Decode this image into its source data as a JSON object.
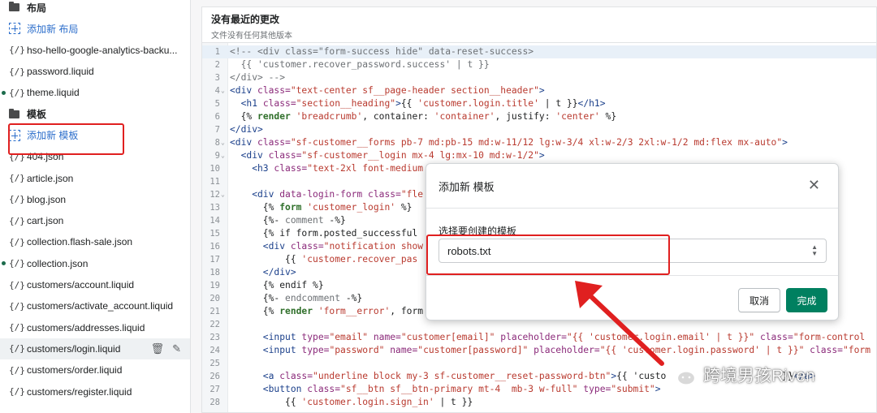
{
  "sidebar": {
    "items": [
      {
        "kind": "folder",
        "label": "布局"
      },
      {
        "kind": "add",
        "label": "添加新 布局"
      },
      {
        "kind": "file",
        "label": "hso-hello-google-analytics-backu...",
        "dot": false
      },
      {
        "kind": "file",
        "label": "password.liquid",
        "dot": false
      },
      {
        "kind": "file",
        "label": "theme.liquid",
        "dot": true
      },
      {
        "kind": "folder",
        "label": "模板"
      },
      {
        "kind": "add",
        "label": "添加新 模板"
      },
      {
        "kind": "file",
        "label": "404.json",
        "dot": false
      },
      {
        "kind": "file",
        "label": "article.json",
        "dot": false
      },
      {
        "kind": "file",
        "label": "blog.json",
        "dot": false
      },
      {
        "kind": "file",
        "label": "cart.json",
        "dot": false
      },
      {
        "kind": "file",
        "label": "collection.flash-sale.json",
        "dot": false
      },
      {
        "kind": "file",
        "label": "collection.json",
        "dot": true
      },
      {
        "kind": "file",
        "label": "customers/account.liquid",
        "dot": false
      },
      {
        "kind": "file",
        "label": "customers/activate_account.liquid",
        "dot": false
      },
      {
        "kind": "file",
        "label": "customers/addresses.liquid",
        "dot": false
      },
      {
        "kind": "file",
        "label": "customers/login.liquid",
        "dot": false,
        "selected": true
      },
      {
        "kind": "file",
        "label": "customers/order.liquid",
        "dot": false
      },
      {
        "kind": "file",
        "label": "customers/register.liquid",
        "dot": false
      }
    ],
    "file_icon": "{/}",
    "colors": {
      "link": "#2c6ecb",
      "dot": "#1c6c4c"
    }
  },
  "editor": {
    "title": "没有最近的更改",
    "subtitle": "文件没有任何其他版本",
    "lines": [
      {
        "n": "1",
        "fold": "",
        "tokens": [
          [
            "cm",
            "<!-- <div class=\"form-success hide\" data-reset-success>"
          ]
        ]
      },
      {
        "n": "2",
        "fold": "",
        "tokens": [
          [
            "cm",
            "  {{ 'customer.recover_password.success' | t }}"
          ]
        ]
      },
      {
        "n": "3",
        "fold": "",
        "tokens": [
          [
            "cm",
            "</div> -->"
          ]
        ]
      },
      {
        "n": "4",
        "fold": "v",
        "tokens": [
          [
            "tag",
            "<div "
          ],
          [
            "attr",
            "class="
          ],
          [
            "str",
            "\"text-center sf__page-header section__header\""
          ],
          [
            "tag",
            ">"
          ]
        ]
      },
      {
        "n": "5",
        "fold": "",
        "tokens": [
          [
            "tag",
            "  <h1 "
          ],
          [
            "attr",
            "class="
          ],
          [
            "str",
            "\"section__heading\""
          ],
          [
            "tag",
            ">"
          ],
          [
            "plain",
            "{{ "
          ],
          [
            "str",
            "'customer.login.title'"
          ],
          [
            "plain",
            " | t }}"
          ],
          [
            "tag",
            "</h1>"
          ]
        ]
      },
      {
        "n": "6",
        "fold": "",
        "tokens": [
          [
            "plain",
            "  {% "
          ],
          [
            "kw",
            "render "
          ],
          [
            "str",
            "'breadcrumb'"
          ],
          [
            "plain",
            ", container: "
          ],
          [
            "str",
            "'container'"
          ],
          [
            "plain",
            ", justify: "
          ],
          [
            "str",
            "'center'"
          ],
          [
            "plain",
            " %}"
          ]
        ]
      },
      {
        "n": "7",
        "fold": "",
        "tokens": [
          [
            "tag",
            "</div>"
          ]
        ]
      },
      {
        "n": "8",
        "fold": "v",
        "tokens": [
          [
            "tag",
            "<div "
          ],
          [
            "attr",
            "class="
          ],
          [
            "str",
            "\"sf-customer__forms pb-7 md:pb-15 md:w-11/12 lg:w-3/4 xl:w-2/3 2xl:w-1/2 md:flex mx-auto\""
          ],
          [
            "tag",
            ">"
          ]
        ]
      },
      {
        "n": "9",
        "fold": "v",
        "tokens": [
          [
            "tag",
            "  <div "
          ],
          [
            "attr",
            "class="
          ],
          [
            "str",
            "\"sf-customer__login mx-4 lg:mx-10 md:w-1/2\""
          ],
          [
            "tag",
            ">"
          ]
        ]
      },
      {
        "n": "10",
        "fold": "",
        "tokens": [
          [
            "tag",
            "    <h3 "
          ],
          [
            "attr",
            "class="
          ],
          [
            "str",
            "\"text-2xl font-medium"
          ]
        ]
      },
      {
        "n": "11",
        "fold": "",
        "tokens": [
          [
            "plain",
            ""
          ]
        ]
      },
      {
        "n": "12",
        "fold": "v",
        "tokens": [
          [
            "tag",
            "    <div "
          ],
          [
            "attr",
            "data-login-form class="
          ],
          [
            "str",
            "\"fle"
          ]
        ]
      },
      {
        "n": "13",
        "fold": "",
        "tokens": [
          [
            "plain",
            "      {% "
          ],
          [
            "kw",
            "form "
          ],
          [
            "str",
            "'customer_login'"
          ],
          [
            "plain",
            " %}"
          ]
        ]
      },
      {
        "n": "14",
        "fold": "",
        "tokens": [
          [
            "plain",
            "      {%- "
          ],
          [
            "cm",
            "comment"
          ],
          [
            "plain",
            " -%}"
          ]
        ]
      },
      {
        "n": "15",
        "fold": "",
        "tokens": [
          [
            "plain",
            "      {% if form.posted_successful"
          ]
        ]
      },
      {
        "n": "16",
        "fold": "",
        "tokens": [
          [
            "tag",
            "      <div "
          ],
          [
            "attr",
            "class="
          ],
          [
            "str",
            "\"notification show"
          ]
        ]
      },
      {
        "n": "17",
        "fold": "",
        "tokens": [
          [
            "plain",
            "          {{ "
          ],
          [
            "str",
            "'customer.recover_pas"
          ]
        ]
      },
      {
        "n": "18",
        "fold": "",
        "tokens": [
          [
            "tag",
            "      </div>"
          ]
        ]
      },
      {
        "n": "19",
        "fold": "",
        "tokens": [
          [
            "plain",
            "      {% endif %}"
          ]
        ]
      },
      {
        "n": "20",
        "fold": "",
        "tokens": [
          [
            "plain",
            "      {%- "
          ],
          [
            "cm",
            "endcomment"
          ],
          [
            "plain",
            " -%}"
          ]
        ]
      },
      {
        "n": "21",
        "fold": "",
        "tokens": [
          [
            "plain",
            "      {% "
          ],
          [
            "kw",
            "render "
          ],
          [
            "str",
            "'form__error'"
          ],
          [
            "plain",
            ", form"
          ]
        ]
      },
      {
        "n": "22",
        "fold": "",
        "tokens": [
          [
            "plain",
            ""
          ]
        ]
      },
      {
        "n": "23",
        "fold": "",
        "tokens": [
          [
            "tag",
            "      <input "
          ],
          [
            "attr",
            "type="
          ],
          [
            "str",
            "\"email\""
          ],
          [
            "attr",
            " name="
          ],
          [
            "str",
            "\"customer[email]\""
          ],
          [
            "attr",
            " placeholder="
          ],
          [
            "str",
            "\"{{ 'customer.login.email' | t }}\""
          ],
          [
            "attr",
            " class="
          ],
          [
            "str",
            "\"form-control"
          ]
        ]
      },
      {
        "n": "24",
        "fold": "",
        "tokens": [
          [
            "tag",
            "      <input "
          ],
          [
            "attr",
            "type="
          ],
          [
            "str",
            "\"password\""
          ],
          [
            "attr",
            " name="
          ],
          [
            "str",
            "\"customer[password]\""
          ],
          [
            "attr",
            " placeholder="
          ],
          [
            "str",
            "\"{{ 'customer.login.password' | t }}\""
          ],
          [
            "attr",
            " class="
          ],
          [
            "str",
            "\"form"
          ]
        ]
      },
      {
        "n": "25",
        "fold": "",
        "tokens": [
          [
            "plain",
            ""
          ]
        ]
      },
      {
        "n": "26",
        "fold": "",
        "tokens": [
          [
            "tag",
            "      <a "
          ],
          [
            "attr",
            "class="
          ],
          [
            "str",
            "\"underline block my-3 sf-customer__reset-password-btn\""
          ],
          [
            "tag",
            ">"
          ],
          [
            "plain",
            "{{ 'custo"
          ],
          [
            "plain",
            "                     }}"
          ],
          [
            "tag",
            "</a>"
          ]
        ]
      },
      {
        "n": "27",
        "fold": "",
        "tokens": [
          [
            "tag",
            "      <button "
          ],
          [
            "attr",
            "class="
          ],
          [
            "str",
            "\"sf__btn sf__btn-primary mt-4  mb-3 w-full\""
          ],
          [
            "attr",
            " type="
          ],
          [
            "str",
            "\"submit\""
          ],
          [
            "tag",
            ">"
          ]
        ]
      },
      {
        "n": "28",
        "fold": "",
        "tokens": [
          [
            "plain",
            "          {{ "
          ],
          [
            "str",
            "'customer.login.sign_in'"
          ],
          [
            "plain",
            " | t }}"
          ]
        ]
      }
    ]
  },
  "modal": {
    "title": "添加新 模板",
    "close_glyph": "✕",
    "field_label": "选择要创建的模板",
    "selected_value": "robots.txt",
    "cancel_label": "取消",
    "done_label": "完成",
    "colors": {
      "primary": "#008060",
      "highlight": "#e02020"
    }
  },
  "watermark": {
    "text": "跨境男孩Riven"
  }
}
